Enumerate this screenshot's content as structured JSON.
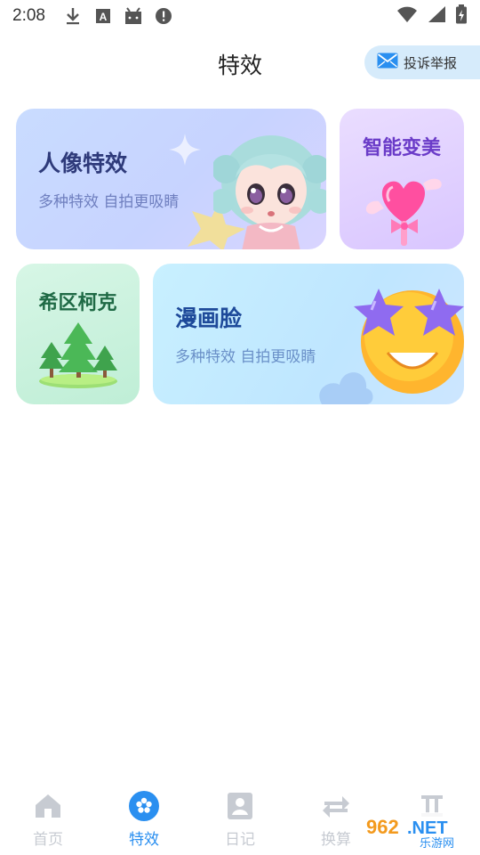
{
  "status_bar": {
    "time": "2:08",
    "icons": [
      "download-icon",
      "a-box-icon",
      "android-icon",
      "alert-icon",
      "wifi-icon",
      "signal-icon",
      "battery-icon"
    ]
  },
  "header": {
    "title": "特效",
    "report_label": "投诉举报"
  },
  "cards": {
    "portrait": {
      "title": "人像特效",
      "subtitle": "多种特效 自拍更吸睛"
    },
    "beauty": {
      "title": "智能变美"
    },
    "haruki": {
      "title": "希区柯克"
    },
    "comic": {
      "title": "漫画脸",
      "subtitle": "多种特效 自拍更吸睛"
    }
  },
  "nav": {
    "items": [
      {
        "label": "首页",
        "icon": "home-icon",
        "active": false
      },
      {
        "label": "特效",
        "icon": "effects-icon",
        "active": true
      },
      {
        "label": "日记",
        "icon": "diary-icon",
        "active": false
      },
      {
        "label": "换算",
        "icon": "convert-icon",
        "active": false
      },
      {
        "label": "",
        "icon": "gemini-icon",
        "active": false
      }
    ]
  },
  "watermark": {
    "text": "962.NET",
    "sub": "乐游网"
  },
  "colors": {
    "accent": "#2a8ff0",
    "inactive": "#c7cbd2",
    "report_bg": "#d6ebfb"
  }
}
